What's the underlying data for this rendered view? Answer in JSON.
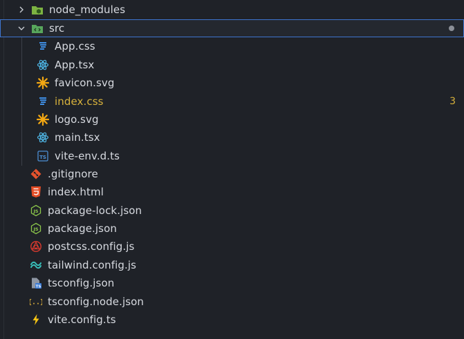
{
  "explorer": {
    "items": [
      {
        "name": "node_modules",
        "type": "folder",
        "icon": "folder-node-icon",
        "collapsed": true
      },
      {
        "name": "src",
        "type": "folder",
        "icon": "folder-src-icon",
        "expanded": true,
        "selected": true
      },
      {
        "name": "App.css",
        "type": "file",
        "icon": "css-icon"
      },
      {
        "name": "App.tsx",
        "type": "file",
        "icon": "react-icon"
      },
      {
        "name": "favicon.svg",
        "type": "file",
        "icon": "svg-icon"
      },
      {
        "name": "index.css",
        "type": "file",
        "icon": "css-icon",
        "status": "warning",
        "badge": "3"
      },
      {
        "name": "logo.svg",
        "type": "file",
        "icon": "svg-icon"
      },
      {
        "name": "main.tsx",
        "type": "file",
        "icon": "react-icon"
      },
      {
        "name": "vite-env.d.ts",
        "type": "file",
        "icon": "ts-icon"
      },
      {
        "name": ".gitignore",
        "type": "file",
        "icon": "git-icon"
      },
      {
        "name": "index.html",
        "type": "file",
        "icon": "html-icon"
      },
      {
        "name": "package-lock.json",
        "type": "file",
        "icon": "node-json-icon"
      },
      {
        "name": "package.json",
        "type": "file",
        "icon": "node-json-icon"
      },
      {
        "name": "postcss.config.js",
        "type": "file",
        "icon": "postcss-icon"
      },
      {
        "name": "tailwind.config.js",
        "type": "file",
        "icon": "tailwind-icon"
      },
      {
        "name": "tsconfig.json",
        "type": "file",
        "icon": "tsconfig-icon"
      },
      {
        "name": "tsconfig.node.json",
        "type": "file",
        "icon": "json-braces-icon"
      },
      {
        "name": "vite.config.ts",
        "type": "file",
        "icon": "vite-icon"
      }
    ]
  },
  "colors": {
    "background": "#1f2228",
    "text": "#d7dae0",
    "warning": "#d8b23c",
    "selection_border": "#3e76d1"
  }
}
